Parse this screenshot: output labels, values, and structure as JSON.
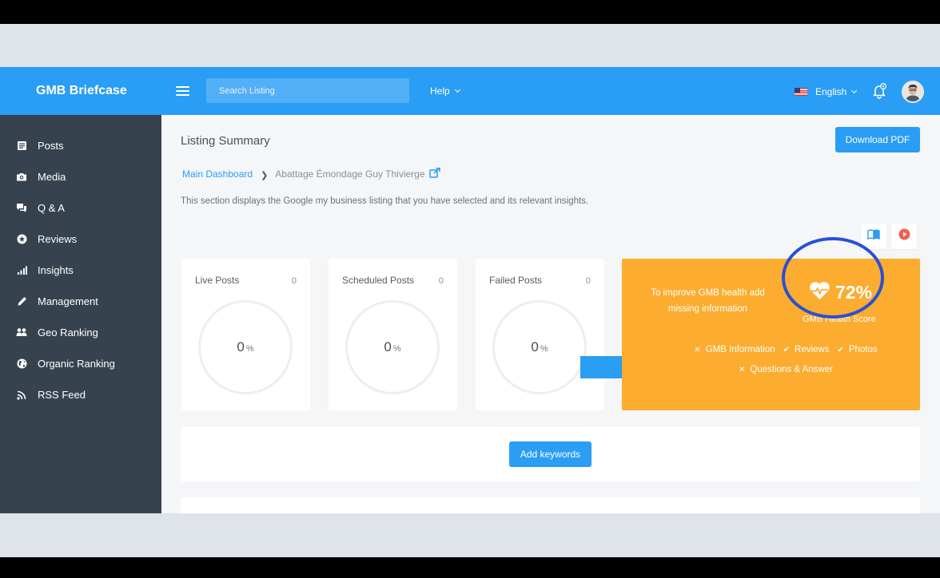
{
  "app": {
    "brand": "GMB Briefcase"
  },
  "header": {
    "search_placeholder": "Search Listing",
    "help_label": "Help",
    "language_label": "English"
  },
  "sidebar": {
    "items": [
      {
        "label": "Posts",
        "icon": "posts-icon"
      },
      {
        "label": "Media",
        "icon": "camera-icon"
      },
      {
        "label": "Q & A",
        "icon": "chat-icon"
      },
      {
        "label": "Reviews",
        "icon": "star-icon"
      },
      {
        "label": "Insights",
        "icon": "bar-chart-icon"
      },
      {
        "label": "Management",
        "icon": "pencil-icon"
      },
      {
        "label": "Geo Ranking",
        "icon": "users-icon"
      },
      {
        "label": "Organic Ranking",
        "icon": "globe-icon"
      },
      {
        "label": "RSS Feed",
        "icon": "rss-icon"
      }
    ]
  },
  "main": {
    "title": "Listing Summary",
    "download_label": "Download PDF",
    "breadcrumb": {
      "root": "Main Dashboard",
      "current": "Abattage Émondage Guy Thivierge"
    },
    "description": "This section displays the Google my business listing that you have selected and its relevant insights.",
    "post_cards": [
      {
        "label": "Live Posts",
        "count": "0",
        "percent": "0"
      },
      {
        "label": "Scheduled Posts",
        "count": "0",
        "percent": "0"
      },
      {
        "label": "Failed Posts",
        "count": "0",
        "percent": "0"
      }
    ],
    "percent_unit": "%",
    "health": {
      "improve_text": "To improve GMB health add missing information",
      "score": "72%",
      "score_label": "GMB Health Score",
      "items": [
        {
          "label": "GMB Information",
          "status": "missing"
        },
        {
          "label": "Reviews",
          "status": "done"
        },
        {
          "label": "Photos",
          "status": "done"
        },
        {
          "label": "Questions & Answer",
          "status": "missing"
        }
      ]
    },
    "add_keywords_label": "Add keywords"
  },
  "colors": {
    "header": "#2a9df4",
    "sidebar": "#36434f",
    "health_card": "#fcac2e",
    "highlight_circle": "#2a4fd6",
    "play_icon": "#f0624d"
  }
}
